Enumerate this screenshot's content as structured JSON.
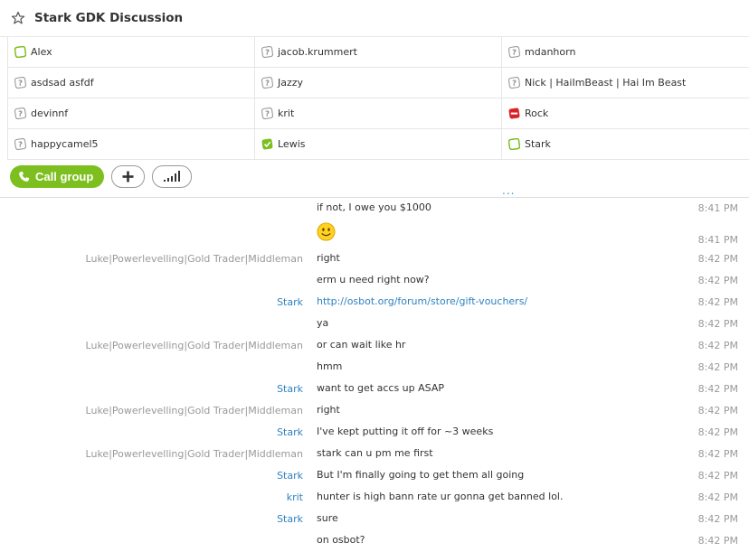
{
  "header": {
    "title": "Stark GDK Discussion"
  },
  "participants": [
    [
      {
        "name": "Alex",
        "status": "online-outline"
      },
      {
        "name": "jacob.krummert",
        "status": "unknown"
      },
      {
        "name": "mdanhorn",
        "status": "unknown"
      }
    ],
    [
      {
        "name": "asdsad asfdf",
        "status": "unknown"
      },
      {
        "name": "Jazzy",
        "status": "unknown"
      },
      {
        "name": "Nick | HaiImBeast | Hai Im Beast",
        "status": "unknown"
      }
    ],
    [
      {
        "name": "devinnf",
        "status": "unknown"
      },
      {
        "name": "krit",
        "status": "unknown"
      },
      {
        "name": "Rock",
        "status": "blocked"
      }
    ],
    [
      {
        "name": "happycamel5",
        "status": "unknown"
      },
      {
        "name": "Lewis",
        "status": "online-check"
      },
      {
        "name": "Stark",
        "status": "online-outline"
      }
    ]
  ],
  "actions": {
    "call_label": "Call group",
    "more": "..."
  },
  "colors": {
    "accent_green": "#7cbf1f",
    "link_blue": "#2f82c1",
    "blocked_red": "#d9232a"
  },
  "messages": [
    {
      "sender": "",
      "text": "if not, I owe you $1000",
      "time": "8:41 PM",
      "me": false
    },
    {
      "sender": "",
      "text": "",
      "time": "8:41 PM",
      "me": false,
      "emoticon": "smile-emoticon"
    },
    {
      "sender": "Luke|Powerlevelling|Gold Trader|Middleman",
      "text": "right",
      "time": "8:42 PM",
      "me": false
    },
    {
      "sender": "",
      "text": "erm u need right now?",
      "time": "8:42 PM",
      "me": false
    },
    {
      "sender": "Stark",
      "text": "http://osbot.org/forum/store/gift-vouchers/",
      "time": "8:42 PM",
      "me": true,
      "link": true
    },
    {
      "sender": "",
      "text": "ya",
      "time": "8:42 PM",
      "me": false
    },
    {
      "sender": "Luke|Powerlevelling|Gold Trader|Middleman",
      "text": "or can wait like hr",
      "time": "8:42 PM",
      "me": false
    },
    {
      "sender": "",
      "text": "hmm",
      "time": "8:42 PM",
      "me": false
    },
    {
      "sender": "Stark",
      "text": "want to get accs up ASAP",
      "time": "8:42 PM",
      "me": true
    },
    {
      "sender": "Luke|Powerlevelling|Gold Trader|Middleman",
      "text": "right",
      "time": "8:42 PM",
      "me": false
    },
    {
      "sender": "Stark",
      "text": "I've kept putting it off for ~3 weeks",
      "time": "8:42 PM",
      "me": true
    },
    {
      "sender": "Luke|Powerlevelling|Gold Trader|Middleman",
      "text": "stark can u pm me first",
      "time": "8:42 PM",
      "me": false
    },
    {
      "sender": "Stark",
      "text": "But I'm finally going to get them all going",
      "time": "8:42 PM",
      "me": true
    },
    {
      "sender": "krit",
      "text": "hunter is high bann rate ur gonna get banned lol.",
      "time": "8:42 PM",
      "me": true
    },
    {
      "sender": "Stark",
      "text": "sure",
      "time": "8:42 PM",
      "me": true
    },
    {
      "sender": "",
      "text": "on osbot?",
      "time": "8:42 PM",
      "me": false
    }
  ]
}
